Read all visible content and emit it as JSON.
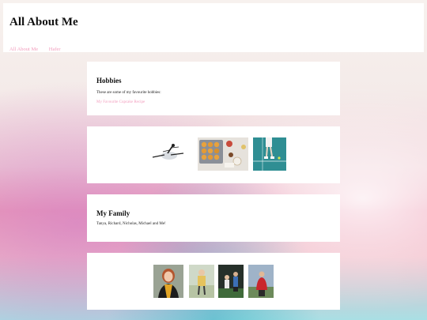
{
  "site": {
    "title": "All About Me"
  },
  "nav": {
    "items": [
      {
        "label": "All About Me"
      },
      {
        "label": "Hafer"
      }
    ]
  },
  "hobbies": {
    "heading": "Hobbies",
    "text": "These are some of my favourite hobbies:",
    "link": "My Favourite Cupcake Recipe"
  },
  "hobby_photos": [
    {
      "icon": "ballet-dancer-photo"
    },
    {
      "icon": "cupcakes-baking-photo"
    },
    {
      "icon": "tennis-court-photo"
    }
  ],
  "family": {
    "heading": "My Family",
    "text": "Tanya, Richard, Nicholas, Michael and Me!"
  },
  "family_photos": [
    {
      "icon": "graduate-portrait-photo"
    },
    {
      "icon": "child-outdoors-photo"
    },
    {
      "icon": "kids-playing-photo"
    },
    {
      "icon": "person-red-jacket-photo"
    }
  ],
  "colors": {
    "link": "#f29dbd",
    "card": "#ffffff",
    "accent_teal": "#2f8e93"
  }
}
